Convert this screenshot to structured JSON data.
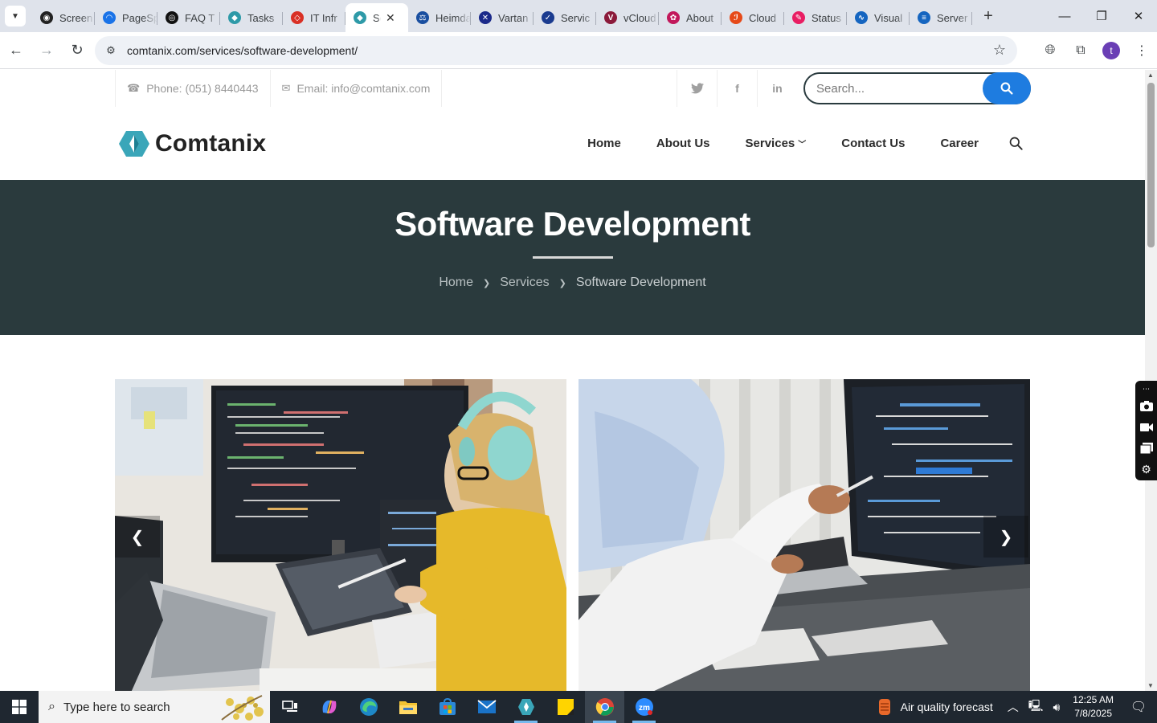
{
  "browser": {
    "tabs": [
      {
        "label": "Screen",
        "favicon_color": "#222222",
        "favicon_glyph": "◉"
      },
      {
        "label": "PageSpeed",
        "favicon_color": "#1a73e8",
        "favicon_glyph": "◠"
      },
      {
        "label": "FAQ T",
        "favicon_color": "#111111",
        "favicon_glyph": "◎"
      },
      {
        "label": "Tasks",
        "favicon_color": "#2e9aa8",
        "favicon_glyph": "◆"
      },
      {
        "label": "IT Infr",
        "favicon_color": "#d93025",
        "favicon_glyph": "◇"
      },
      {
        "label": "Software Development",
        "favicon_color": "#2e9aa8",
        "favicon_glyph": "◆",
        "active": true
      },
      {
        "label": "Heimdal",
        "favicon_color": "#1a4fa0",
        "favicon_glyph": "⚖"
      },
      {
        "label": "Vartan",
        "favicon_color": "#1b2a8a",
        "favicon_glyph": "✕"
      },
      {
        "label": "Servic",
        "favicon_color": "#1a3b8f",
        "favicon_glyph": "✓"
      },
      {
        "label": "vCloud",
        "favicon_color": "#8b1a3a",
        "favicon_glyph": "V"
      },
      {
        "label": "About",
        "favicon_color": "#c2185b",
        "favicon_glyph": "✿"
      },
      {
        "label": "Cloud",
        "favicon_color": "#e64a19",
        "favicon_glyph": "ℐ"
      },
      {
        "label": "Status",
        "favicon_color": "#e91e63",
        "favicon_glyph": "✎"
      },
      {
        "label": "Visual",
        "favicon_color": "#1565c0",
        "favicon_glyph": "∿"
      },
      {
        "label": "Server",
        "favicon_color": "#1565c0",
        "favicon_glyph": "≡"
      }
    ],
    "url": "comtanix.com/services/software-development/",
    "profile_initial": "t"
  },
  "topbar": {
    "phone": "Phone: (051) 8440443",
    "email": "Email: info@comtanix.com",
    "social": [
      "twitter-icon",
      "facebook-icon",
      "linkedin-icon"
    ],
    "search_placeholder": "Search..."
  },
  "header": {
    "logo_text": "Comtanix",
    "nav": [
      {
        "label": "Home"
      },
      {
        "label": "About Us"
      },
      {
        "label": "Services",
        "has_dropdown": true
      },
      {
        "label": "Contact Us"
      },
      {
        "label": "Career"
      }
    ]
  },
  "hero": {
    "title": "Software Development",
    "breadcrumb": [
      "Home",
      "Services",
      "Software Development"
    ]
  },
  "carousel": {
    "slides": [
      "developer-with-headphones-photo",
      "developers-pointing-at-screen-photo"
    ]
  },
  "taskbar": {
    "search_text": "Type here to search",
    "weather_label": "Air quality forecast",
    "time": "12:25 AM",
    "date": "7/8/2025"
  },
  "colors": {
    "hero_bg": "#2a3a3d",
    "accent_blue": "#1e7ce0",
    "logo_teal": "#3aa6b9"
  }
}
